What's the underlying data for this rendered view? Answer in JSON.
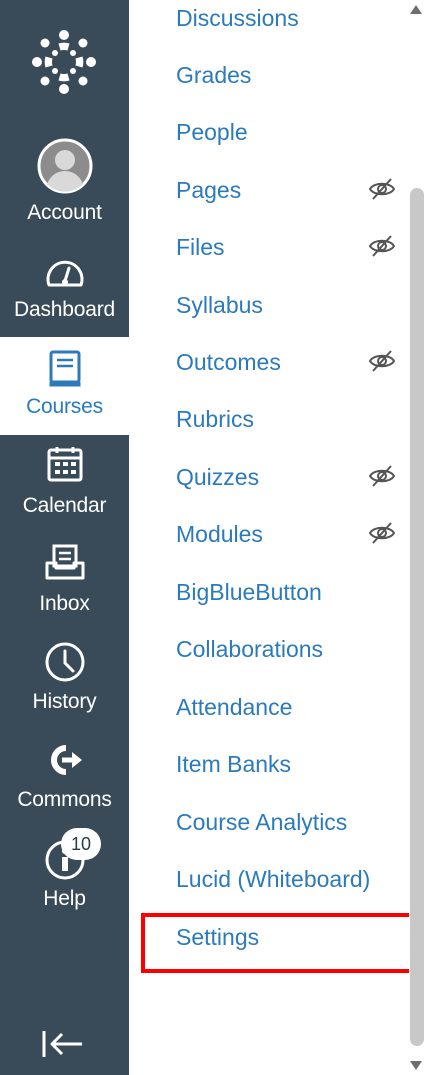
{
  "global_nav": {
    "items": [
      {
        "label": "Account",
        "icon": "avatar-icon"
      },
      {
        "label": "Dashboard",
        "icon": "dashboard-icon"
      },
      {
        "label": "Courses",
        "icon": "courses-icon",
        "active": true
      },
      {
        "label": "Calendar",
        "icon": "calendar-icon"
      },
      {
        "label": "Inbox",
        "icon": "inbox-icon"
      },
      {
        "label": "History",
        "icon": "history-icon"
      },
      {
        "label": "Commons",
        "icon": "commons-icon"
      },
      {
        "label": "Help",
        "icon": "help-icon",
        "badge": "10"
      }
    ],
    "bg_color": "#394b58",
    "active_color": "#2b7abc"
  },
  "course_nav": {
    "items": [
      {
        "label": "Discussions",
        "hidden": false
      },
      {
        "label": "Grades",
        "hidden": false
      },
      {
        "label": "People",
        "hidden": false
      },
      {
        "label": "Pages",
        "hidden": true
      },
      {
        "label": "Files",
        "hidden": true
      },
      {
        "label": "Syllabus",
        "hidden": false
      },
      {
        "label": "Outcomes",
        "hidden": true
      },
      {
        "label": "Rubrics",
        "hidden": false
      },
      {
        "label": "Quizzes",
        "hidden": true
      },
      {
        "label": "Modules",
        "hidden": true
      },
      {
        "label": "BigBlueButton",
        "hidden": false
      },
      {
        "label": "Collaborations",
        "hidden": false
      },
      {
        "label": "Attendance",
        "hidden": false
      },
      {
        "label": "Item Banks",
        "hidden": false
      },
      {
        "label": "Course Analytics",
        "hidden": false
      },
      {
        "label": "Lucid (Whiteboard)",
        "hidden": false
      },
      {
        "label": "Settings",
        "hidden": false,
        "highlighted": true
      }
    ],
    "link_color": "#2b7abc",
    "highlight_color": "#ff0000"
  }
}
